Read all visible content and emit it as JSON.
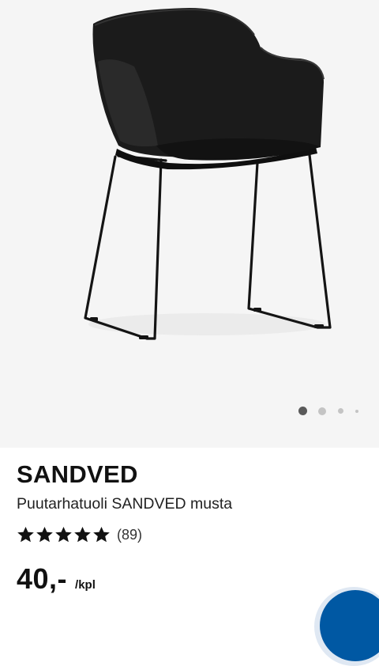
{
  "product": {
    "name": "SANDVED",
    "description": "Puutarhatuoli SANDVED musta",
    "rating_count": "(89)",
    "rating": 5,
    "rating_max": 5,
    "price": "40,-",
    "price_unit": "/kpl"
  },
  "gallery": {
    "image": "black-armchair-sled-legs",
    "page_count": 4,
    "active_page": 1
  },
  "colors": {
    "gallery_bg": "#f5f5f5",
    "text": "#111111",
    "fab": "#0058a3"
  }
}
